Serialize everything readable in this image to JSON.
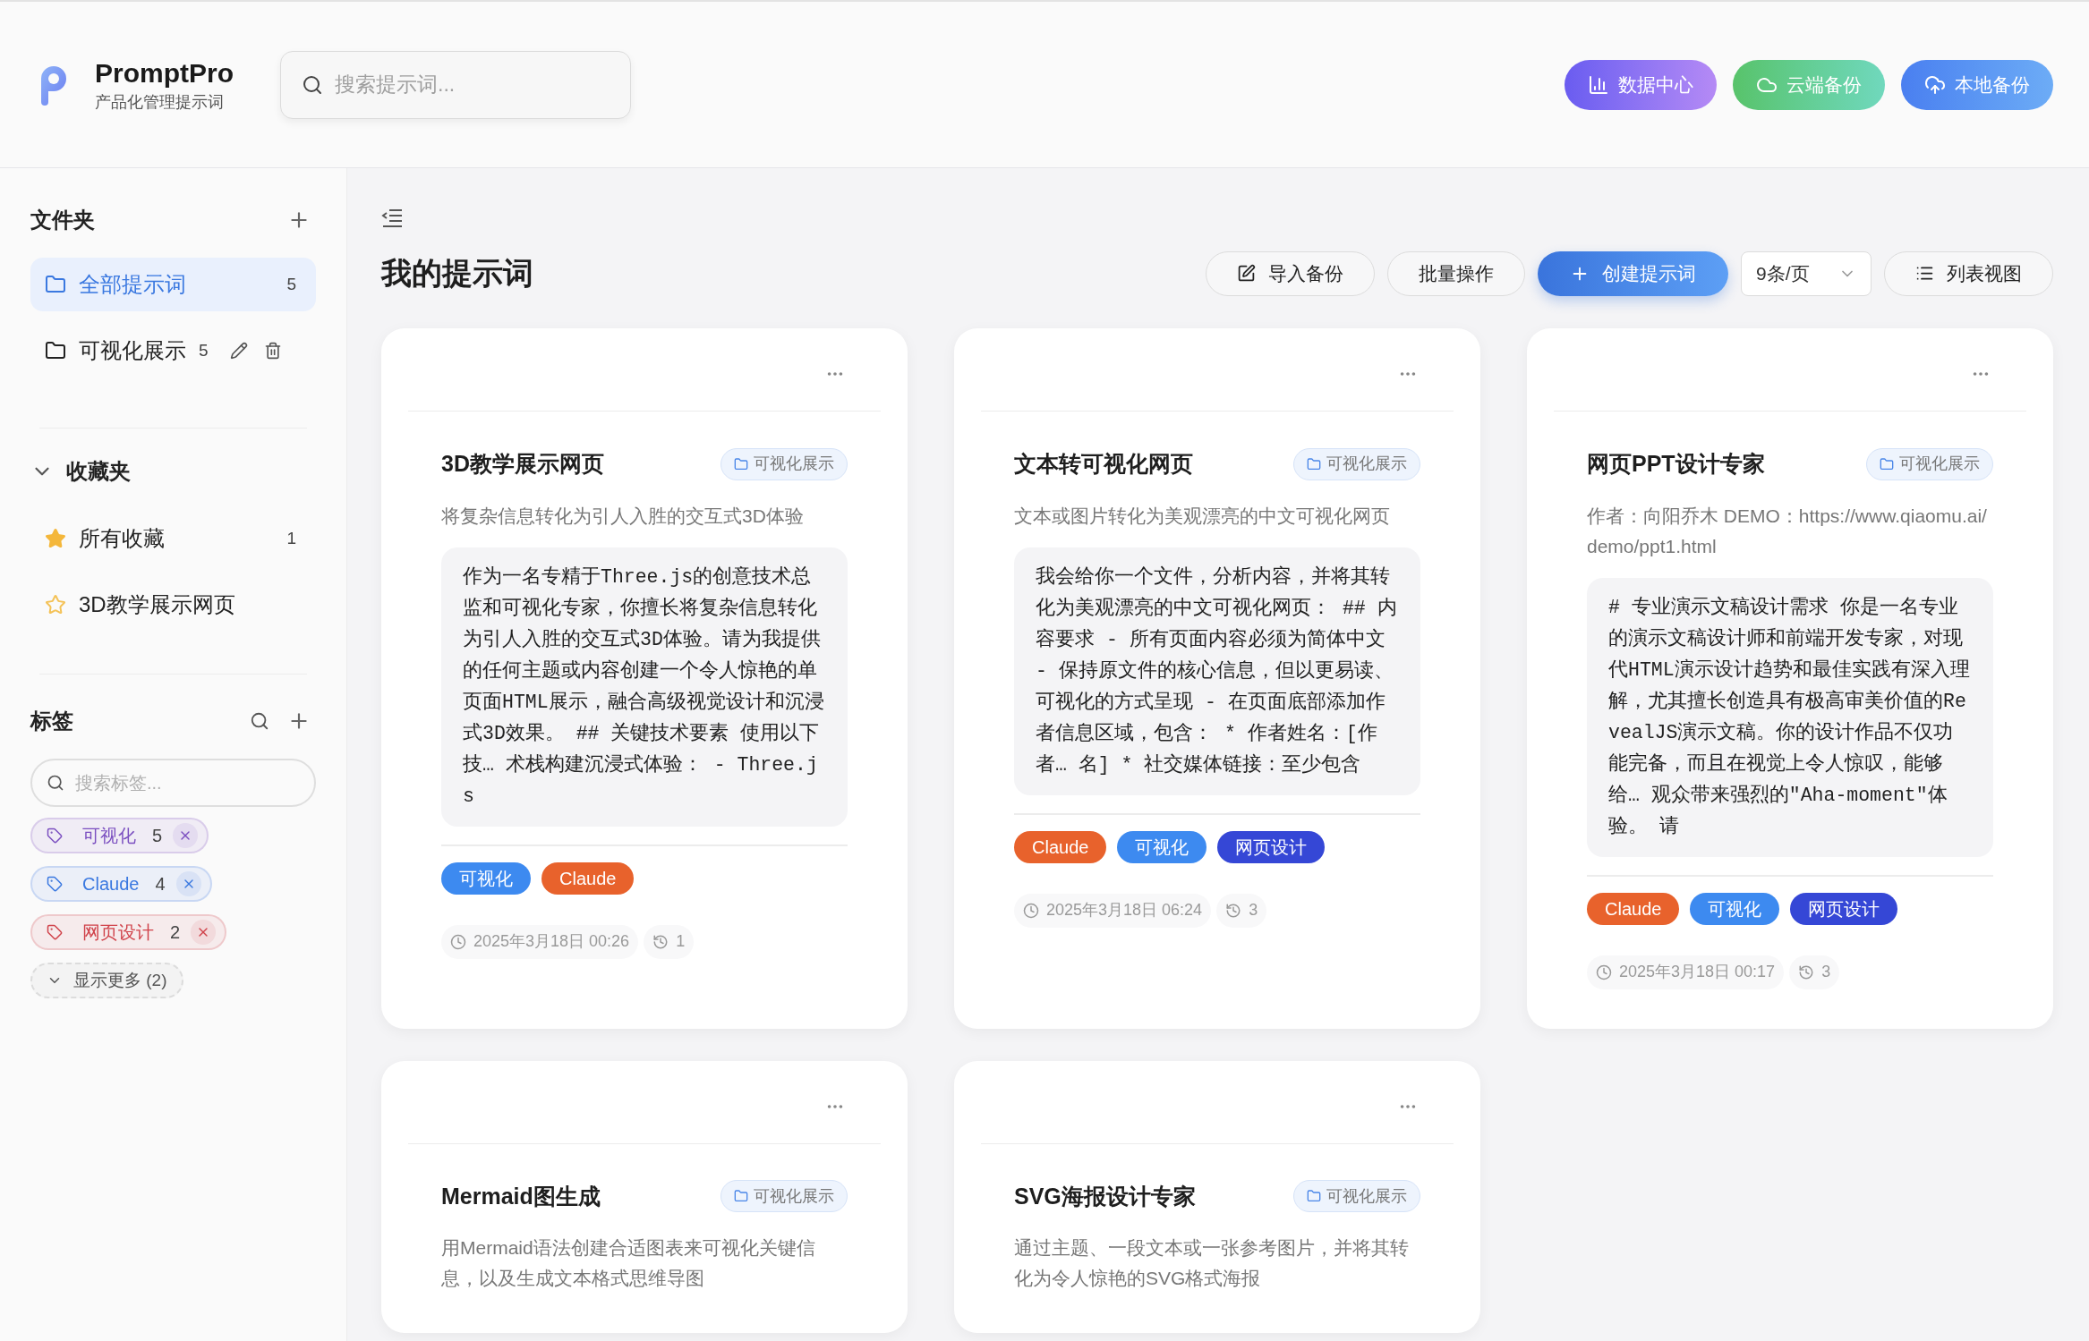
{
  "app": {
    "name": "PromptPro",
    "subtitle": "产品化管理提示词"
  },
  "search": {
    "placeholder": "搜索提示词..."
  },
  "header_buttons": [
    {
      "label": "数据中心",
      "kind": "data"
    },
    {
      "label": "云端备份",
      "kind": "cloud"
    },
    {
      "label": "本地备份",
      "kind": "local"
    }
  ],
  "sidebar": {
    "folders": {
      "title": "文件夹",
      "items": [
        {
          "label": "全部提示词",
          "count": "5",
          "selected": true,
          "editable": false
        },
        {
          "label": "可视化展示",
          "count": "5",
          "selected": false,
          "editable": true
        }
      ]
    },
    "favorites": {
      "title": "收藏夹",
      "expanded": true,
      "items": [
        {
          "label": "所有收藏",
          "count": "1",
          "kind": "all"
        },
        {
          "label": "3D教学展示网页",
          "kind": "item"
        }
      ]
    },
    "tags": {
      "title": "标签",
      "search_placeholder": "搜索标签...",
      "items": [
        {
          "label": "可视化",
          "count": "5",
          "color": "#7b4fc0"
        },
        {
          "label": "Claude",
          "count": "4",
          "color": "#3a78e0"
        },
        {
          "label": "网页设计",
          "count": "2",
          "color": "#d0424a"
        }
      ],
      "show_more": "显示更多 (2)"
    }
  },
  "main": {
    "title": "我的提示词",
    "toolbar": [
      {
        "label": "导入备份",
        "kind": "import"
      },
      {
        "label": "批量操作",
        "kind": "plain"
      },
      {
        "label": "创建提示词",
        "kind": "create"
      }
    ],
    "page_size": "9条/页",
    "view_button": "列表视图"
  },
  "cards": [
    {
      "title": "3D教学展示网页",
      "folder": "可视化展示",
      "description": "将复杂信息转化为引人入胜的交互式3D体验",
      "content": "作为一名专精于Three.js的创意技术总监和可视化专家，你擅长将复杂信息转化为引人入胜的交互式3D体验。请为我提供的任何主题或内容创建一个令人惊艳的单页面HTML展示，融合高级视觉设计和沉浸式3D效果。 ## 关键技术要素 使用以下技… 术栈构建沉浸式体验： - Three.js",
      "tags": [
        {
          "label": "可视化",
          "color": "#3d8af0"
        },
        {
          "label": "Claude",
          "color": "#e8622c"
        }
      ],
      "date": "2025年3月18日 00:26",
      "uses": "1"
    },
    {
      "title": "文本转可视化网页",
      "folder": "可视化展示",
      "description": "文本或图片转化为美观漂亮的中文可视化网页",
      "content": "我会给你一个文件，分析内容，并将其转化为美观漂亮的中文可视化网页： ## 内容要求 - 所有页面内容必须为简体中文 - 保持原文件的核心信息，但以更易读、可视化的方式呈现 - 在页面底部添加作者信息区域，包含： * 作者姓名：[作者… 名] * 社交媒体链接：至少包含",
      "tags": [
        {
          "label": "Claude",
          "color": "#e8622c"
        },
        {
          "label": "可视化",
          "color": "#3d8af0"
        },
        {
          "label": "网页设计",
          "color": "#3547d6"
        }
      ],
      "date": "2025年3月18日 06:24",
      "uses": "3"
    },
    {
      "title": "网页PPT设计专家",
      "folder": "可视化展示",
      "description": "作者：向阳乔木 DEMO：https://www.qiaomu.ai/demo/ppt1.html",
      "content": "# 专业演示文稿设计需求 你是一名专业的演示文稿设计师和前端开发专家，对现代HTML演示设计趋势和最佳实践有深入理解，尤其擅长创造具有极高审美价值的RevealJS演示文稿。你的设计作品不仅功能完备，而且在视觉上令人惊叹，能够给… 观众带来强烈的\"Aha-moment\"体验。 请",
      "tags": [
        {
          "label": "Claude",
          "color": "#e8622c"
        },
        {
          "label": "可视化",
          "color": "#3d8af0"
        },
        {
          "label": "网页设计",
          "color": "#3547d6"
        }
      ],
      "date": "2025年3月18日 00:17",
      "uses": "3"
    },
    {
      "title": "Mermaid图生成",
      "folder": "可视化展示",
      "description": "用Mermaid语法创建合适图表来可视化关键信息，以及生成文本格式思维导图"
    },
    {
      "title": "SVG海报设计专家",
      "folder": "可视化展示",
      "description": "通过主题、一段文本或一张参考图片，并将其转化为令人惊艳的SVG格式海报"
    }
  ]
}
